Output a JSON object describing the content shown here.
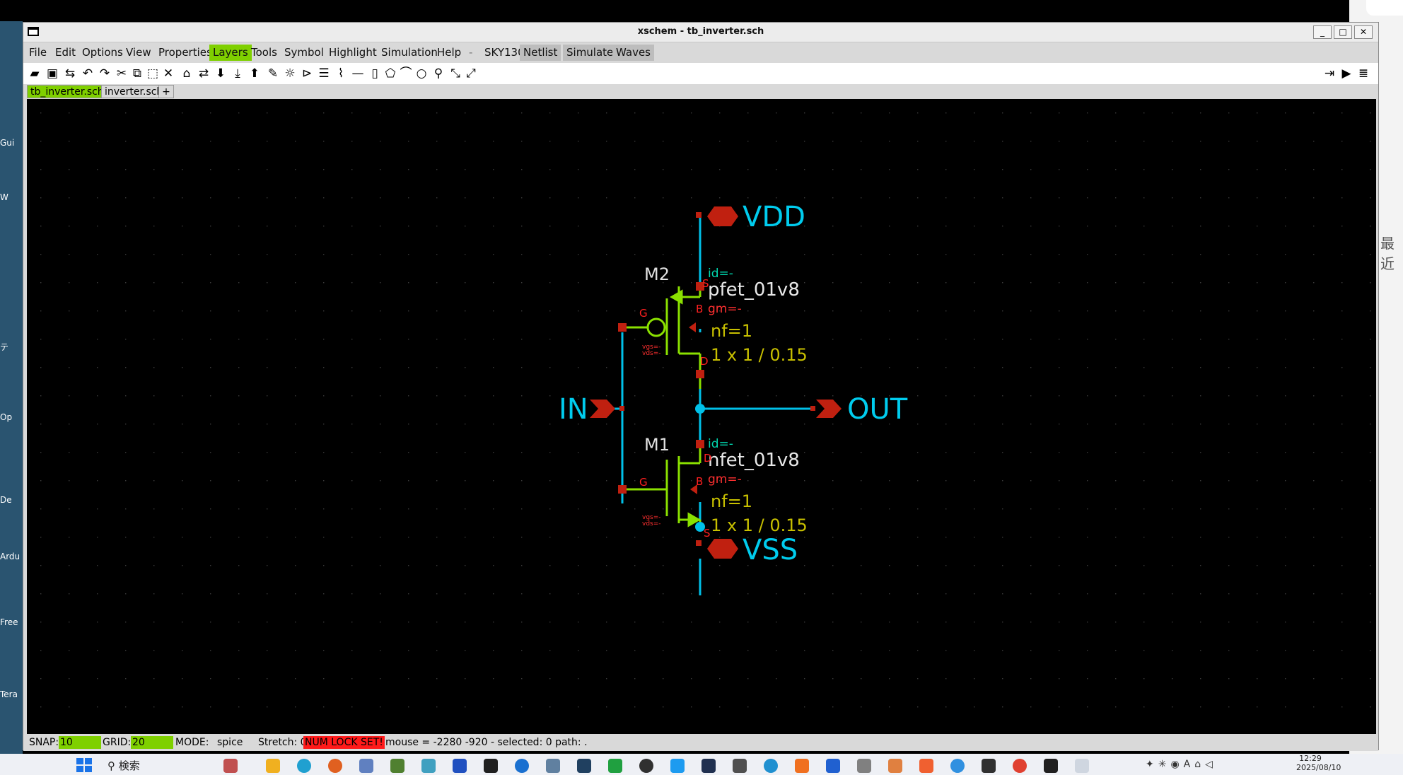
{
  "window": {
    "title": "xschem - tb_inverter.sch"
  },
  "menu": {
    "items": [
      "File",
      "Edit",
      "Options",
      "View",
      "Properties",
      "Layers",
      "Tools",
      "Symbol",
      "Highlight",
      "Simulation",
      "Help",
      "-",
      "SKY130",
      "Netlist",
      "Simulate",
      "Waves"
    ],
    "highlighted": "Layers",
    "active_bg": "#7fd000"
  },
  "tabs": [
    {
      "label": "tb_inverter.sch",
      "active": true
    },
    {
      "label": "inverter.sch",
      "active": false
    },
    {
      "label": "+",
      "active": false
    }
  ],
  "schematic": {
    "pins": {
      "vdd": "VDD",
      "vss": "VSS",
      "in": "IN",
      "out": "OUT"
    },
    "m2": {
      "name": "M2",
      "model": "pfet_01v8",
      "id": "id=-",
      "gm": "gm=-",
      "nf": "nf=1",
      "size": "1 x 1 / 0.15",
      "vgs": "vgs=-",
      "vds": "vds=-",
      "g": "G",
      "s": "S",
      "b": "B",
      "d": "D"
    },
    "m1": {
      "name": "M1",
      "model": "nfet_01v8",
      "id": "id=-",
      "gm": "gm=-",
      "nf": "nf=1",
      "size": "1 x 1 / 0.15",
      "vgs": "vgs=-",
      "vds": "vds=-",
      "g": "G",
      "d": "D",
      "b": "B",
      "s": "S"
    },
    "colors": {
      "wire": "#00c0e8",
      "device": "#8ae000",
      "pin": "#c02010",
      "label": "#00ccee",
      "param": "#c8c000",
      "text": "#e0e0e0",
      "red": "#ff2020"
    }
  },
  "status": {
    "snap_label": "SNAP:",
    "snap_value": "10",
    "grid_label": "GRID:",
    "grid_value": "20",
    "mode_label": "MODE:",
    "mode_value": "spice",
    "stretch": "Stretch: 0",
    "numlock": "NUM LOCK SET!",
    "mouse": "mouse = -2280 -920 - selected: 0 path: ."
  },
  "taskbar": {
    "search": "検索",
    "time": "12:29",
    "date": "2025/08/10"
  },
  "desktop": {
    "labels": [
      "Gui",
      "W",
      "テ",
      "Op",
      "De",
      "Ardu",
      "Free",
      "Tera"
    ],
    "right_label": "最近"
  }
}
